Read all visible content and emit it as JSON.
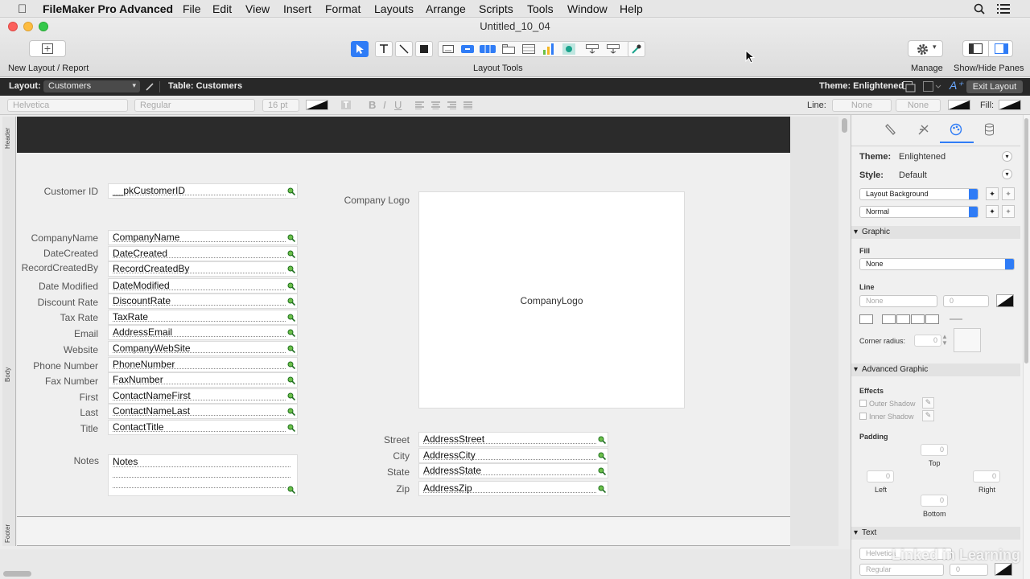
{
  "menubar": {
    "app": "FileMaker Pro Advanced",
    "items": [
      "File",
      "Edit",
      "View",
      "Insert",
      "Format",
      "Layouts",
      "Arrange",
      "Scripts",
      "Tools",
      "Window",
      "Help"
    ]
  },
  "window": {
    "title": "Untitled_10_04"
  },
  "toolbar": {
    "new_layout": "New Layout / Report",
    "layout_tools": "Layout Tools",
    "manage": "Manage",
    "show_hide": "Show/Hide Panes"
  },
  "layoutbar": {
    "layout_label": "Layout:",
    "layout_value": "Customers",
    "table": "Table: Customers",
    "theme": "Theme: Enlightened",
    "exit": "Exit Layout"
  },
  "formatbar": {
    "font": "Helvetica",
    "style": "Regular",
    "size": "16 pt",
    "line_label": "Line:",
    "line1": "None",
    "line2": "None",
    "fill_label": "Fill:"
  },
  "parts": {
    "header": "Header",
    "body": "Body",
    "footer": "Footer"
  },
  "fields": [
    {
      "label": "Customer ID",
      "value": "__pkCustomerID"
    },
    {
      "label": "CompanyName",
      "value": "CompanyName"
    },
    {
      "label": "DateCreated",
      "value": "DateCreated"
    },
    {
      "label": "RecordCreatedBy",
      "value": "RecordCreatedBy"
    },
    {
      "label": "Date Modified",
      "value": "DateModified"
    },
    {
      "label": "Discount Rate",
      "value": "DiscountRate"
    },
    {
      "label": "Tax Rate",
      "value": "TaxRate"
    },
    {
      "label": "Email",
      "value": "AddressEmail"
    },
    {
      "label": "Website",
      "value": "CompanyWebSite"
    },
    {
      "label": "Phone Number",
      "value": "PhoneNumber"
    },
    {
      "label": "Fax Number",
      "value": "FaxNumber"
    },
    {
      "label": "First",
      "value": "ContactNameFirst"
    },
    {
      "label": "Last",
      "value": "ContactNameLast"
    },
    {
      "label": "Title",
      "value": "ContactTitle"
    },
    {
      "label": "Notes",
      "value": "Notes"
    }
  ],
  "address": [
    {
      "label": "Street",
      "value": "AddressStreet"
    },
    {
      "label": "City",
      "value": "AddressCity"
    },
    {
      "label": "State",
      "value": "AddressState"
    },
    {
      "label": "Zip",
      "value": "AddressZip"
    }
  ],
  "logo": {
    "label": "Company Logo",
    "value": "CompanyLogo"
  },
  "inspector": {
    "theme_label": "Theme:",
    "theme_value": "Enlightened",
    "style_label": "Style:",
    "style_value": "Default",
    "object_select": "Layout Background",
    "state_select": "Normal",
    "graphic": "Graphic",
    "fill": "Fill",
    "fill_value": "None",
    "line": "Line",
    "line_value": "None",
    "line_width": "0",
    "corner_radius": "Corner radius:",
    "corner_value": "0",
    "advanced": "Advanced Graphic",
    "effects": "Effects",
    "outer_shadow": "Outer Shadow",
    "inner_shadow": "Inner Shadow",
    "padding": "Padding",
    "top": "Top",
    "left": "Left",
    "right": "Right",
    "bottom": "Bottom",
    "pad_value": "0",
    "text": "Text",
    "text_font": "Helvetica",
    "text_style": "Regular",
    "text_size": "0"
  },
  "watermark": "Linked in Learning",
  "colors": {
    "accent": "#2f7cf6",
    "header_part": "#2b2b2b",
    "green_icon": "#2a9a2a"
  }
}
